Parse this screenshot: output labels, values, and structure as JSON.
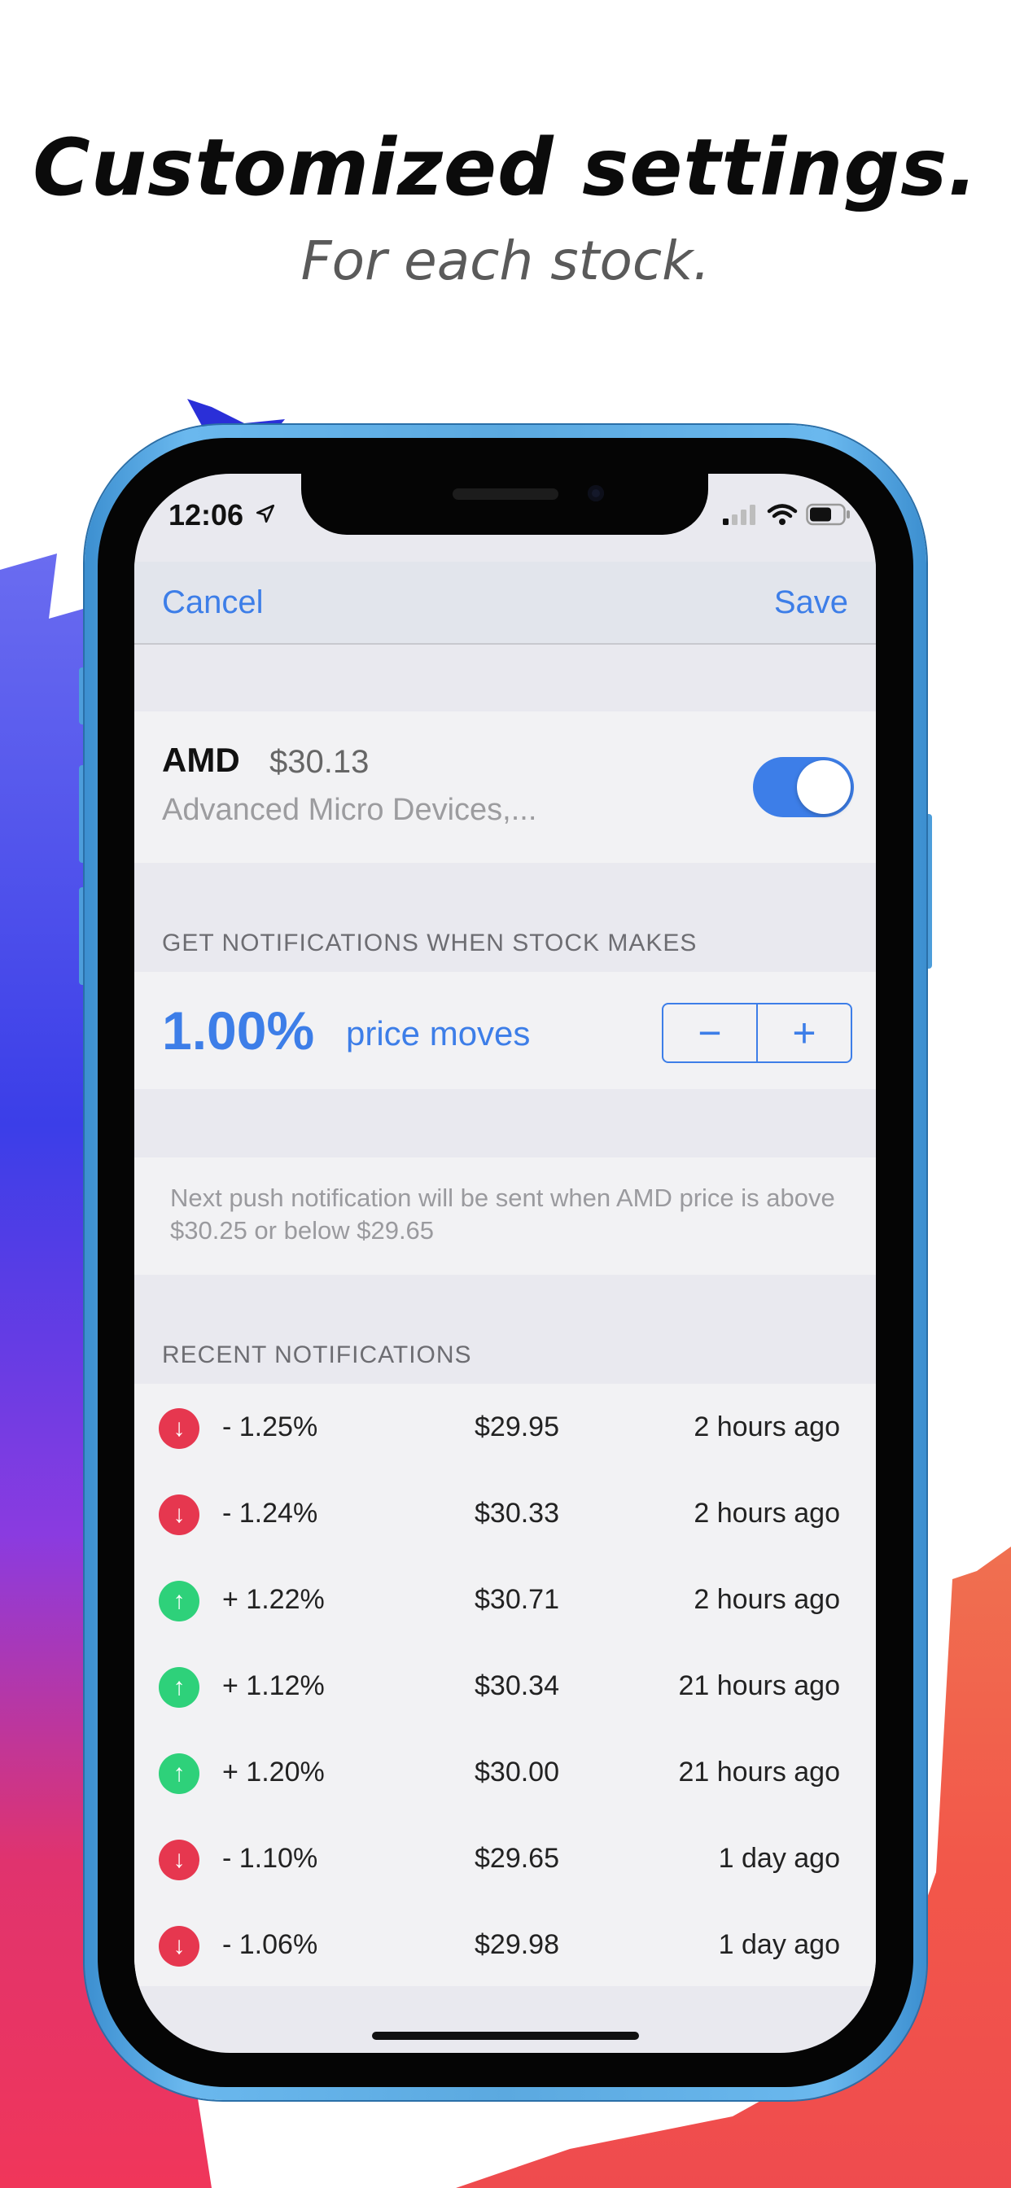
{
  "headline": "Customized settings.",
  "subheadline": "For each stock.",
  "status_bar": {
    "time": "12:06"
  },
  "nav": {
    "cancel": "Cancel",
    "save": "Save"
  },
  "stock": {
    "ticker": "AMD",
    "price": "$30.13",
    "company": "Advanced Micro Devices,...",
    "notifications_enabled": true
  },
  "threshold_section": {
    "label": "GET NOTIFICATIONS WHEN STOCK MAKES",
    "percent": "1.00%",
    "suffix": "price moves",
    "minus": "−",
    "plus": "+"
  },
  "info": {
    "text": "Next push notification will be sent when AMD price is above $30.25 or below $29.65"
  },
  "recent": {
    "label": "RECENT NOTIFICATIONS",
    "rows": [
      {
        "direction": "down",
        "arrow": "↓",
        "change": "- 1.25%",
        "price": "$29.95",
        "time": "2 hours ago"
      },
      {
        "direction": "down",
        "arrow": "↓",
        "change": "- 1.24%",
        "price": "$30.33",
        "time": "2 hours ago"
      },
      {
        "direction": "up",
        "arrow": "↑",
        "change": "+ 1.22%",
        "price": "$30.71",
        "time": "2 hours ago"
      },
      {
        "direction": "up",
        "arrow": "↑",
        "change": "+ 1.12%",
        "price": "$30.34",
        "time": "21 hours ago"
      },
      {
        "direction": "up",
        "arrow": "↑",
        "change": "+ 1.20%",
        "price": "$30.00",
        "time": "21 hours ago"
      },
      {
        "direction": "down",
        "arrow": "↓",
        "change": "- 1.10%",
        "price": "$29.65",
        "time": "1 day ago"
      },
      {
        "direction": "down",
        "arrow": "↓",
        "change": "- 1.06%",
        "price": "$29.98",
        "time": "1 day ago"
      }
    ]
  },
  "colors": {
    "accent": "#3d7ee8",
    "down": "#e6374f",
    "up": "#2ed17a",
    "phone_frame": "#5ba9e0"
  }
}
